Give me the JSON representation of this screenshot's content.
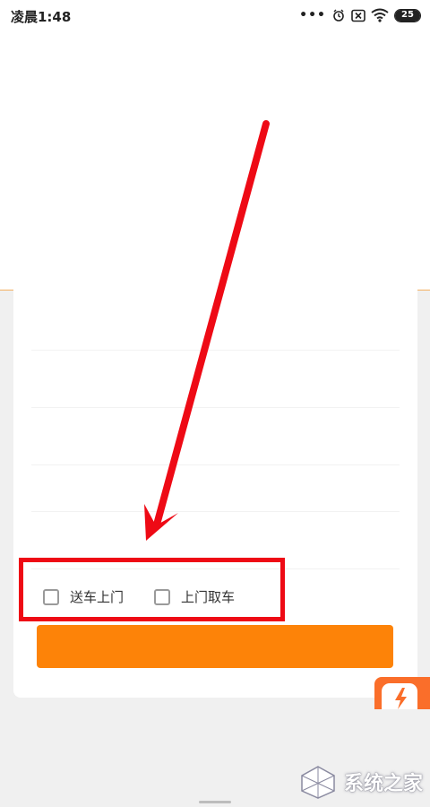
{
  "status_bar": {
    "time": "凌晨1:48",
    "dots": "•••",
    "battery_level": "25",
    "icons": [
      "alarm-icon",
      "sim-off-icon",
      "wifi-icon",
      "battery-icon"
    ]
  },
  "service_options": [
    {
      "label": "送车上门",
      "checked": false
    },
    {
      "label": "上门取车",
      "checked": false
    }
  ],
  "colors": {
    "accent": "#fd8308",
    "annotation_red": "#ee0a15",
    "float_badge": "#fa6e2a"
  },
  "watermark": {
    "brand": "系统之家"
  }
}
